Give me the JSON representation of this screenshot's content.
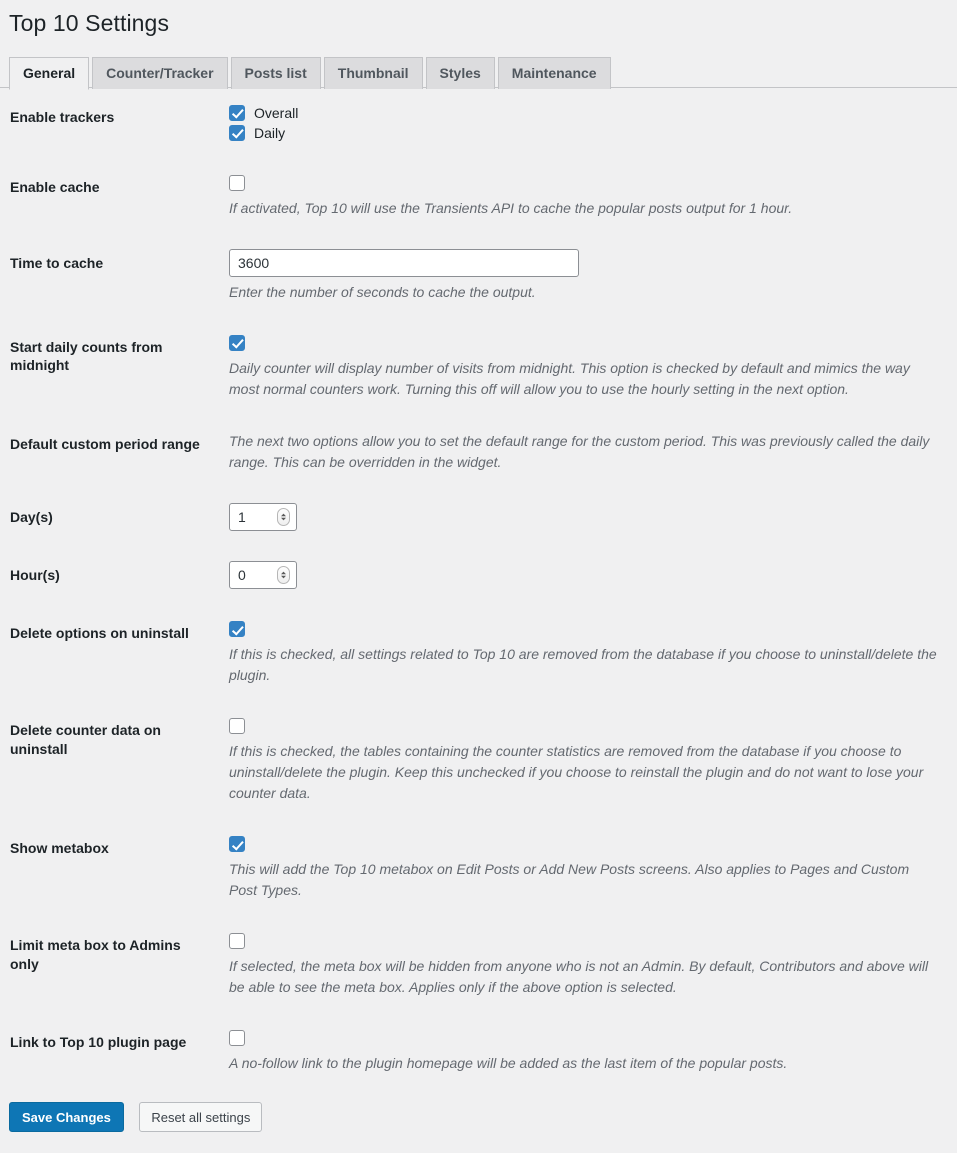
{
  "page": {
    "title": "Top 10 Settings"
  },
  "tabs": [
    {
      "label": "General",
      "active": true
    },
    {
      "label": "Counter/Tracker",
      "active": false
    },
    {
      "label": "Posts list",
      "active": false
    },
    {
      "label": "Thumbnail",
      "active": false
    },
    {
      "label": "Styles",
      "active": false
    },
    {
      "label": "Maintenance",
      "active": false
    }
  ],
  "settings": {
    "enable_trackers": {
      "label": "Enable trackers",
      "options": [
        {
          "label": "Overall",
          "checked": true
        },
        {
          "label": "Daily",
          "checked": true
        }
      ]
    },
    "enable_cache": {
      "label": "Enable cache",
      "checked": false,
      "description": "If activated, Top 10 will use the Transients API to cache the popular posts output for 1 hour."
    },
    "time_to_cache": {
      "label": "Time to cache",
      "value": "3600",
      "description": "Enter the number of seconds to cache the output."
    },
    "start_daily_counts": {
      "label": "Start daily counts from midnight",
      "checked": true,
      "description": "Daily counter will display number of visits from midnight. This option is checked by default and mimics the way most normal counters work. Turning this off will allow you to use the hourly setting in the next option."
    },
    "default_custom_period": {
      "label": "Default custom period range",
      "description": "The next two options allow you to set the default range for the custom period. This was previously called the daily range. This can be overridden in the widget."
    },
    "days": {
      "label": "Day(s)",
      "value": "1"
    },
    "hours": {
      "label": "Hour(s)",
      "value": "0"
    },
    "delete_options_uninstall": {
      "label": "Delete options on uninstall",
      "checked": true,
      "description": "If this is checked, all settings related to Top 10 are removed from the database if you choose to uninstall/delete the plugin."
    },
    "delete_counter_uninstall": {
      "label": "Delete counter data on uninstall",
      "checked": false,
      "description": "If this is checked, the tables containing the counter statistics are removed from the database if you choose to uninstall/delete the plugin. Keep this unchecked if you choose to reinstall the plugin and do not want to lose your counter data."
    },
    "show_metabox": {
      "label": "Show metabox",
      "checked": true,
      "description": "This will add the Top 10 metabox on Edit Posts or Add New Posts screens. Also applies to Pages and Custom Post Types."
    },
    "limit_metabox_admins": {
      "label": "Limit meta box to Admins only",
      "checked": false,
      "description": "If selected, the meta box will be hidden from anyone who is not an Admin. By default, Contributors and above will be able to see the meta box. Applies only if the above option is selected."
    },
    "link_to_plugin": {
      "label": "Link to Top 10 plugin page",
      "checked": false,
      "description": "A no-follow link to the plugin homepage will be added as the last item of the popular posts."
    }
  },
  "footer": {
    "save_label": "Save Changes",
    "reset_label": "Reset all settings"
  },
  "colors": {
    "background": "#f0f0f1",
    "checkbox_checked": "#3582c4",
    "primary_button": "#0e76b5",
    "label_text": "#1d2327",
    "description_text": "#646970",
    "tab_inactive": "#dcdcde",
    "border": "#c3c4c7"
  }
}
